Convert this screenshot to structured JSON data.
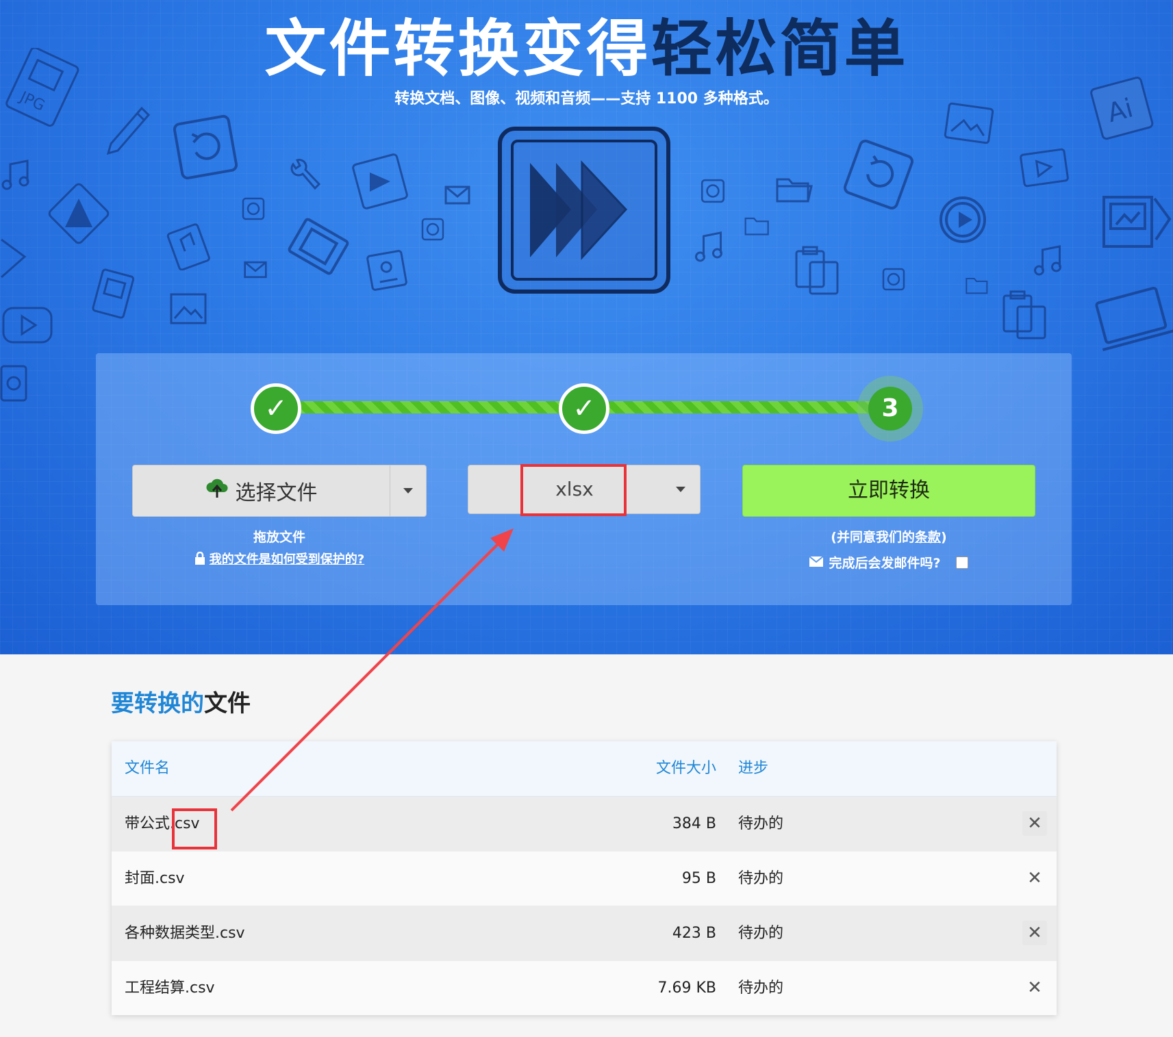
{
  "hero": {
    "title_part1": "文件转换变得",
    "title_part2": "轻松简单",
    "subtitle": "转换文档、图像、视频和音频——支持 1100 多种格式。"
  },
  "steps": {
    "step1": "✓",
    "step2": "✓",
    "step3": "3"
  },
  "converter": {
    "choose_file_label": "选择文件",
    "drop_files_label": "拖放文件",
    "protect_link": "我的文件是如何受到保护的?",
    "format_value": "xlsx",
    "convert_button": "立即转换",
    "terms_prefix": "(并同意我们的",
    "terms_link": "条款",
    "terms_suffix": ")",
    "email_label": "完成后会发邮件吗?"
  },
  "files_section": {
    "title_blue": "要转换的",
    "title_dark": "文件",
    "columns": {
      "name": "文件名",
      "size": "文件大小",
      "progress": "进步"
    },
    "rows": [
      {
        "name": "带公式.csv",
        "size": "384 B",
        "status": "待办的"
      },
      {
        "name": "封面.csv",
        "size": "95 B",
        "status": "待办的"
      },
      {
        "name": "各种数据类型.csv",
        "size": "423 B",
        "status": "待办的"
      },
      {
        "name": "工程结算.csv",
        "size": "7.69 KB",
        "status": "待办的"
      }
    ],
    "remove_glyph": "✕"
  },
  "colors": {
    "hero_blue": "#2c7ae6",
    "accent_green": "#9af35a",
    "step_green": "#3aa92e",
    "highlight_red": "#e8333a",
    "link_blue": "#1f86d6"
  },
  "decorative_icons": [
    "jpg-file-icon",
    "pencil-icon",
    "music-note-icon",
    "refresh-icon",
    "wrench-icon",
    "film-icon",
    "mail-icon",
    "mp3-file-icon",
    "mov-file-icon",
    "image-icon",
    "folder-icon",
    "clipboard-icon",
    "play-icon",
    "ai-file-icon",
    "monitor-icon",
    "laptop-icon"
  ]
}
